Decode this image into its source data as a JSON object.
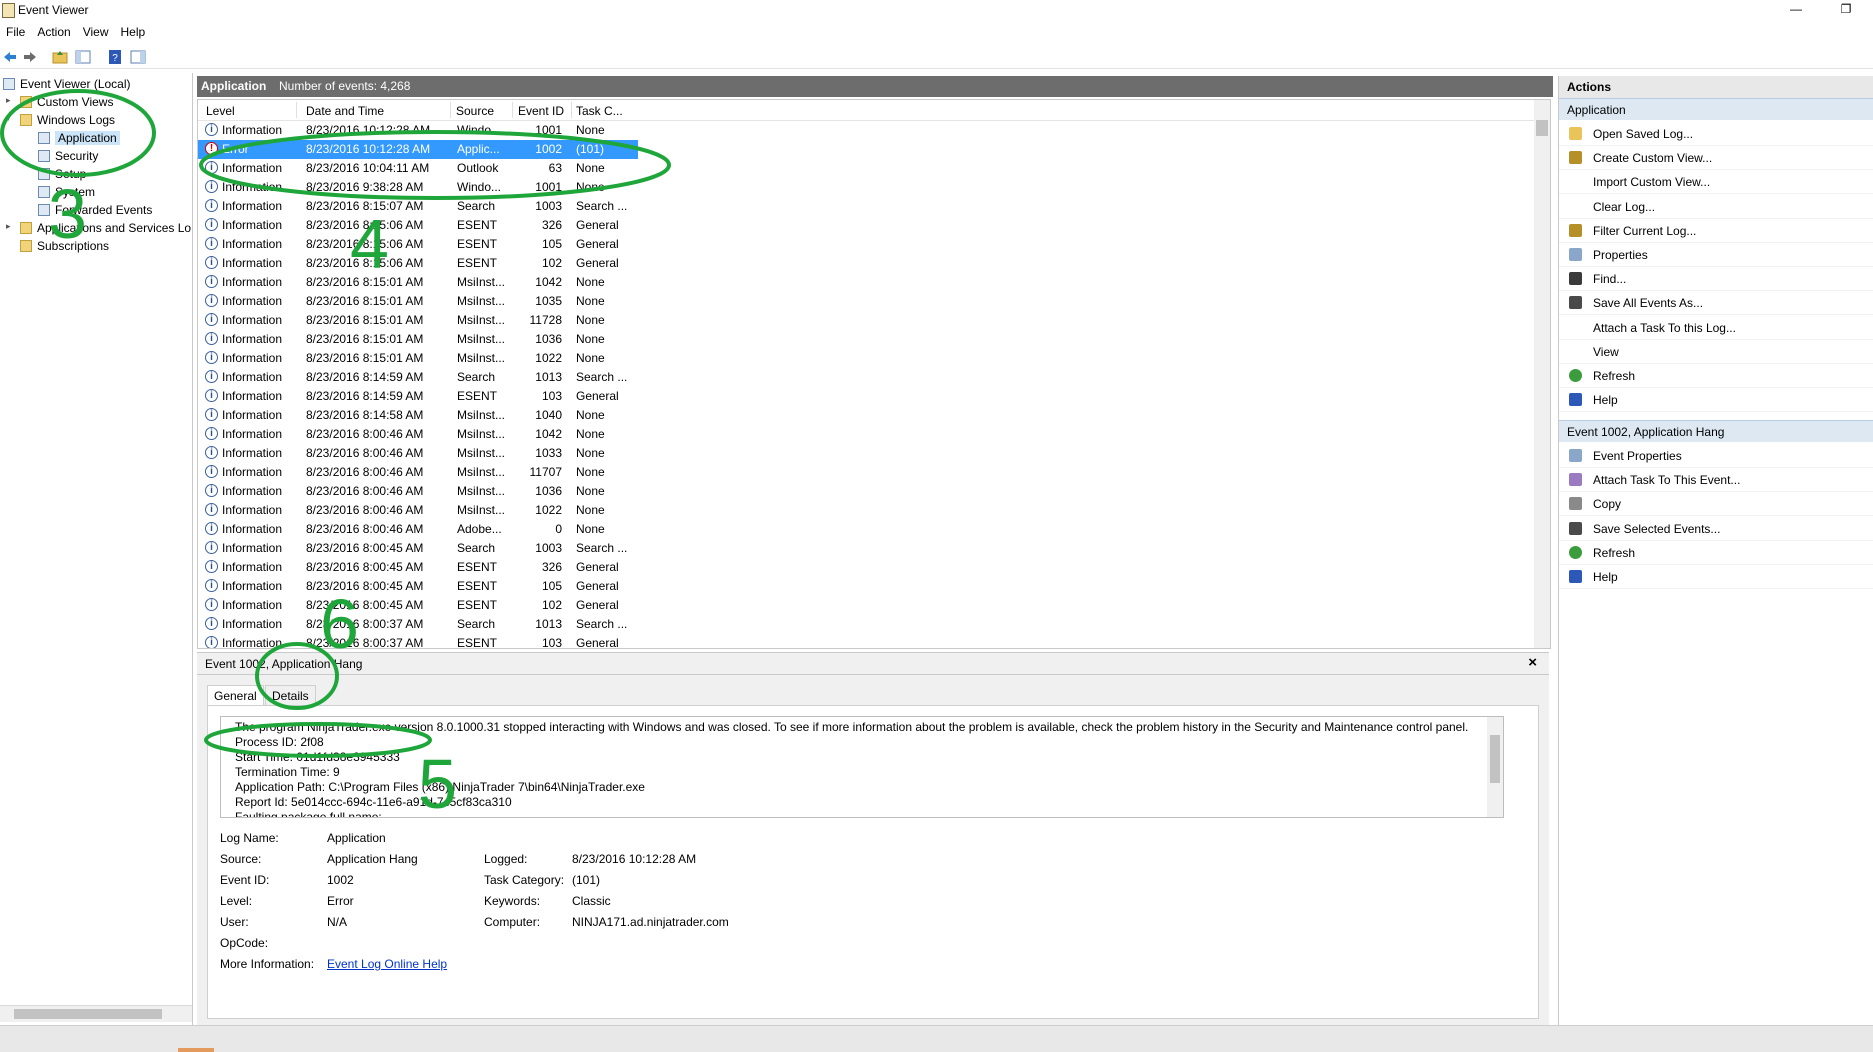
{
  "window": {
    "title": "Event Viewer"
  },
  "menu": [
    "File",
    "Action",
    "View",
    "Help"
  ],
  "tree": {
    "root": "Event Viewer (Local)",
    "custom_views": "Custom Views",
    "windows_logs": "Windows Logs",
    "application": "Application",
    "security": "Security",
    "setup": "Setup",
    "system": "System",
    "forwarded_events": "Forwarded Events",
    "apps_services": "Applications and Services Lo",
    "subscriptions": "Subscriptions"
  },
  "center": {
    "log_name": "Application",
    "event_count": "Number of events: 4,268",
    "columns": [
      "Level",
      "Date and Time",
      "Source",
      "Event ID",
      "Task C..."
    ]
  },
  "events": [
    {
      "level": "Information",
      "date": "8/23/2016 10:12:28 AM",
      "source": "Windo...",
      "id": "1001",
      "task": "None",
      "type": "info"
    },
    {
      "level": "Error",
      "date": "8/23/2016 10:12:28 AM",
      "source": "Applic...",
      "id": "1002",
      "task": "(101)",
      "type": "error"
    },
    {
      "level": "Information",
      "date": "8/23/2016 10:04:11 AM",
      "source": "Outlook",
      "id": "63",
      "task": "None",
      "type": "info"
    },
    {
      "level": "Information",
      "date": "8/23/2016 9:38:28 AM",
      "source": "Windo...",
      "id": "1001",
      "task": "None",
      "type": "info"
    },
    {
      "level": "Information",
      "date": "8/23/2016 8:15:07 AM",
      "source": "Search",
      "id": "1003",
      "task": "Search ...",
      "type": "info"
    },
    {
      "level": "Information",
      "date": "8/23/2016 8:15:06 AM",
      "source": "ESENT",
      "id": "326",
      "task": "General",
      "type": "info"
    },
    {
      "level": "Information",
      "date": "8/23/2016 8:15:06 AM",
      "source": "ESENT",
      "id": "105",
      "task": "General",
      "type": "info"
    },
    {
      "level": "Information",
      "date": "8/23/2016 8:15:06 AM",
      "source": "ESENT",
      "id": "102",
      "task": "General",
      "type": "info"
    },
    {
      "level": "Information",
      "date": "8/23/2016 8:15:01 AM",
      "source": "MsiInst...",
      "id": "1042",
      "task": "None",
      "type": "info"
    },
    {
      "level": "Information",
      "date": "8/23/2016 8:15:01 AM",
      "source": "MsiInst...",
      "id": "1035",
      "task": "None",
      "type": "info"
    },
    {
      "level": "Information",
      "date": "8/23/2016 8:15:01 AM",
      "source": "MsiInst...",
      "id": "11728",
      "task": "None",
      "type": "info"
    },
    {
      "level": "Information",
      "date": "8/23/2016 8:15:01 AM",
      "source": "MsiInst...",
      "id": "1036",
      "task": "None",
      "type": "info"
    },
    {
      "level": "Information",
      "date": "8/23/2016 8:15:01 AM",
      "source": "MsiInst...",
      "id": "1022",
      "task": "None",
      "type": "info"
    },
    {
      "level": "Information",
      "date": "8/23/2016 8:14:59 AM",
      "source": "Search",
      "id": "1013",
      "task": "Search ...",
      "type": "info"
    },
    {
      "level": "Information",
      "date": "8/23/2016 8:14:59 AM",
      "source": "ESENT",
      "id": "103",
      "task": "General",
      "type": "info"
    },
    {
      "level": "Information",
      "date": "8/23/2016 8:14:58 AM",
      "source": "MsiInst...",
      "id": "1040",
      "task": "None",
      "type": "info"
    },
    {
      "level": "Information",
      "date": "8/23/2016 8:00:46 AM",
      "source": "MsiInst...",
      "id": "1042",
      "task": "None",
      "type": "info"
    },
    {
      "level": "Information",
      "date": "8/23/2016 8:00:46 AM",
      "source": "MsiInst...",
      "id": "1033",
      "task": "None",
      "type": "info"
    },
    {
      "level": "Information",
      "date": "8/23/2016 8:00:46 AM",
      "source": "MsiInst...",
      "id": "11707",
      "task": "None",
      "type": "info"
    },
    {
      "level": "Information",
      "date": "8/23/2016 8:00:46 AM",
      "source": "MsiInst...",
      "id": "1036",
      "task": "None",
      "type": "info"
    },
    {
      "level": "Information",
      "date": "8/23/2016 8:00:46 AM",
      "source": "MsiInst...",
      "id": "1022",
      "task": "None",
      "type": "info"
    },
    {
      "level": "Information",
      "date": "8/23/2016 8:00:46 AM",
      "source": "Adobe...",
      "id": "0",
      "task": "None",
      "type": "info"
    },
    {
      "level": "Information",
      "date": "8/23/2016 8:00:45 AM",
      "source": "Search",
      "id": "1003",
      "task": "Search ...",
      "type": "info"
    },
    {
      "level": "Information",
      "date": "8/23/2016 8:00:45 AM",
      "source": "ESENT",
      "id": "326",
      "task": "General",
      "type": "info"
    },
    {
      "level": "Information",
      "date": "8/23/2016 8:00:45 AM",
      "source": "ESENT",
      "id": "105",
      "task": "General",
      "type": "info"
    },
    {
      "level": "Information",
      "date": "8/23/2016 8:00:45 AM",
      "source": "ESENT",
      "id": "102",
      "task": "General",
      "type": "info"
    },
    {
      "level": "Information",
      "date": "8/23/2016 8:00:37 AM",
      "source": "Search",
      "id": "1013",
      "task": "Search ...",
      "type": "info"
    },
    {
      "level": "Information",
      "date": "8/23/2016 8:00:37 AM",
      "source": "ESENT",
      "id": "103",
      "task": "General",
      "type": "info"
    }
  ],
  "detail": {
    "header": "Event 1002, Application Hang",
    "close": "×",
    "tabs": [
      "General",
      "Details"
    ],
    "description_lines": [
      "The program NinjaTrader.exe version 8.0.1000.31 stopped interacting with Windows and was closed. To see if more information about the problem is available, check the problem history in the Security and Maintenance control panel.",
      "Process ID: 2f08",
      "Start Time: 01d1fd38e3945333",
      "Termination Time: 9",
      "Application Path: C:\\Program Files (x86)\\NinjaTrader 7\\bin64\\NinjaTrader.exe",
      "Report Id: 5e014ccc-694c-11e6-a91d-7c5cf83ca310",
      "Faulting package full name:"
    ],
    "fields": {
      "log_name_label": "Log Name:",
      "log_name": "Application",
      "source_label": "Source:",
      "source": "Application Hang",
      "logged_label": "Logged:",
      "logged": "8/23/2016 10:12:28 AM",
      "event_id_label": "Event ID:",
      "event_id": "1002",
      "task_cat_label": "Task Category:",
      "task_cat": "(101)",
      "level_label": "Level:",
      "level": "Error",
      "keywords_label": "Keywords:",
      "keywords": "Classic",
      "user_label": "User:",
      "user": "N/A",
      "computer_label": "Computer:",
      "computer": "NINJA171.ad.ninjatrader.com",
      "opcode_label": "OpCode:",
      "opcode": "",
      "more_info_label": "More Information:",
      "more_info_link": "Event Log Online Help"
    }
  },
  "actions": {
    "title": "Actions",
    "section1": "Application",
    "items1": [
      "Open Saved Log...",
      "Create Custom View...",
      "Import Custom View...",
      "Clear Log...",
      "Filter Current Log...",
      "Properties",
      "Find...",
      "Save All Events As...",
      "Attach a Task To this Log...",
      "View",
      "Refresh",
      "Help"
    ],
    "section2": "Event 1002, Application Hang",
    "items2": [
      "Event Properties",
      "Attach Task To This Event...",
      "Copy",
      "Save Selected Events...",
      "Refresh",
      "Help"
    ]
  },
  "annotations": [
    "3",
    "4",
    "5",
    "6"
  ],
  "colors": {
    "annotation": "#1fa63a",
    "selection": "#3399ff",
    "header_bg": "#6d6d6d",
    "action_section": "#dde8f3"
  }
}
